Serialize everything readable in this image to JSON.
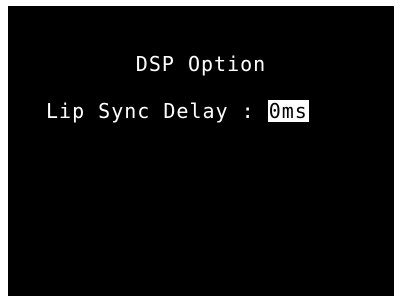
{
  "osd": {
    "title": "DSP Option",
    "setting": {
      "label": "Lip Sync Delay",
      "separator": " : ",
      "value": "0ms"
    }
  },
  "colors": {
    "background": "#000000",
    "text": "#ffffff",
    "highlight_bg": "#ffffff",
    "highlight_text": "#000000"
  }
}
